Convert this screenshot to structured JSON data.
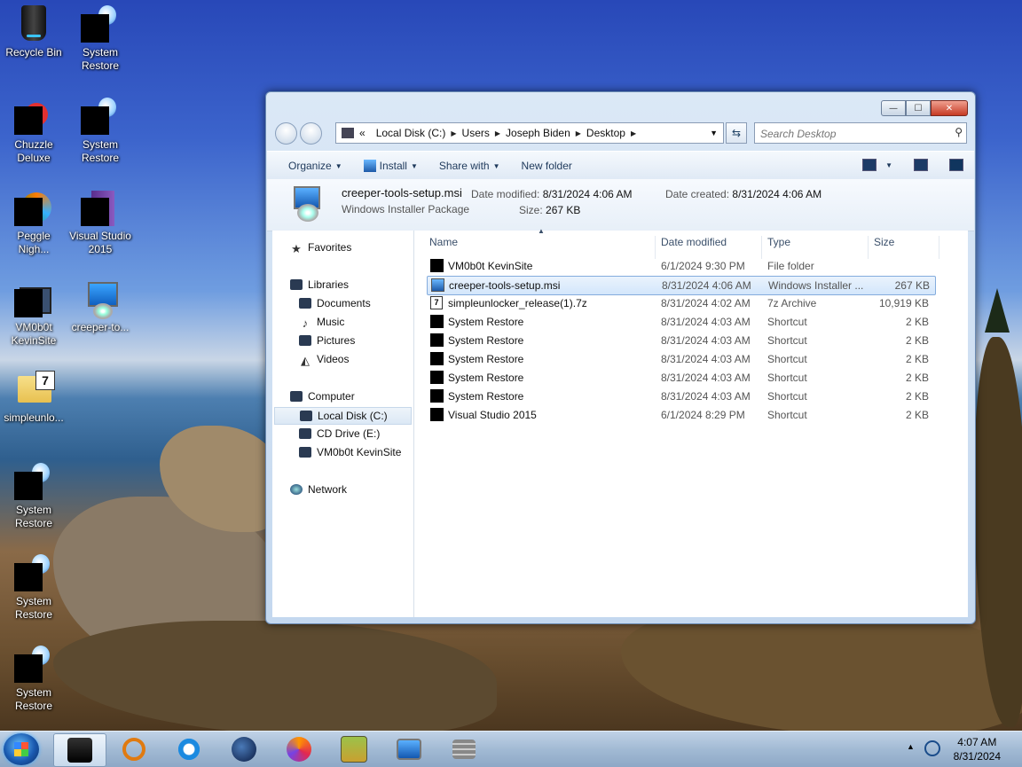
{
  "desktop": {
    "icons": [
      {
        "label": "Recycle Bin"
      },
      {
        "label": "System Restore"
      },
      {
        "label": "Chuzzle Deluxe"
      },
      {
        "label": "System Restore"
      },
      {
        "label": "Peggle Nigh..."
      },
      {
        "label": "Visual Studio 2015"
      },
      {
        "label": "VM0b0t KevinSite"
      },
      {
        "label": "creeper-to..."
      },
      {
        "label": "simpleunlo..."
      },
      {
        "label": "System Restore"
      },
      {
        "label": "System Restore"
      },
      {
        "label": "System Restore"
      }
    ]
  },
  "window": {
    "controls": {
      "minimize": "—",
      "maximize": "☐",
      "close": "✕"
    },
    "address": {
      "prefix": "«",
      "crumbs": [
        "Local Disk (C:)",
        "Users",
        "Joseph Biden",
        "Desktop"
      ]
    },
    "search": {
      "placeholder": "Search Desktop"
    },
    "toolbar": {
      "organize": "Organize",
      "install": "Install",
      "share_with": "Share with",
      "new_folder": "New folder"
    },
    "details": {
      "name": "creeper-tools-setup.msi",
      "type": "Windows Installer Package",
      "date_modified_label": "Date modified:",
      "date_modified": "8/31/2024 4:06 AM",
      "date_created_label": "Date created:",
      "date_created": "8/31/2024 4:06 AM",
      "size_label": "Size:",
      "size": "267 KB"
    },
    "nav": {
      "favorites": "Favorites",
      "libraries": "Libraries",
      "documents": "Documents",
      "music": "Music",
      "pictures": "Pictures",
      "videos": "Videos",
      "computer": "Computer",
      "local_disk": "Local Disk (C:)",
      "cd_drive": "CD Drive (E:)",
      "vm": "VM0b0t KevinSite",
      "network": "Network"
    },
    "columns": {
      "name": "Name",
      "date": "Date modified",
      "type": "Type",
      "size": "Size"
    },
    "files": [
      {
        "name": "VM0b0t KevinSite",
        "date": "6/1/2024 9:30 PM",
        "type": "File folder",
        "size": ""
      },
      {
        "name": "creeper-tools-setup.msi",
        "date": "8/31/2024 4:06 AM",
        "type": "Windows Installer ...",
        "size": "267 KB"
      },
      {
        "name": "simpleunlocker_release(1).7z",
        "date": "8/31/2024 4:02 AM",
        "type": "7z Archive",
        "size": "10,919 KB"
      },
      {
        "name": "System Restore",
        "date": "8/31/2024 4:03 AM",
        "type": "Shortcut",
        "size": "2 KB"
      },
      {
        "name": "System Restore",
        "date": "8/31/2024 4:03 AM",
        "type": "Shortcut",
        "size": "2 KB"
      },
      {
        "name": "System Restore",
        "date": "8/31/2024 4:03 AM",
        "type": "Shortcut",
        "size": "2 KB"
      },
      {
        "name": "System Restore",
        "date": "8/31/2024 4:03 AM",
        "type": "Shortcut",
        "size": "2 KB"
      },
      {
        "name": "System Restore",
        "date": "8/31/2024 4:03 AM",
        "type": "Shortcut",
        "size": "2 KB"
      },
      {
        "name": "Visual Studio 2015",
        "date": "6/1/2024 8:29 PM",
        "type": "Shortcut",
        "size": "2 KB"
      }
    ]
  },
  "taskbar": {
    "time": "4:07 AM",
    "date": "8/31/2024",
    "tray_arrow": "▲"
  }
}
